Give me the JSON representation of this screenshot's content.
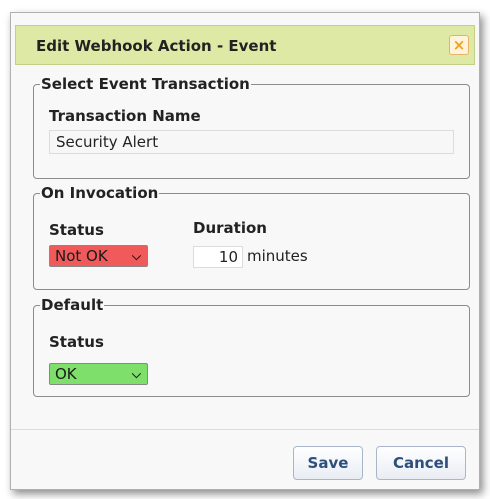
{
  "dialog": {
    "title": "Edit Webhook Action - Event",
    "close_glyph": "×"
  },
  "select_event": {
    "legend": "Select Event Transaction",
    "name_label": "Transaction Name",
    "name_value": "Security Alert"
  },
  "on_invocation": {
    "legend": "On Invocation",
    "status_label": "Status",
    "status_value": "Not OK",
    "status_color": "#f05a5a",
    "duration_label": "Duration",
    "duration_value": "10",
    "duration_unit": "minutes"
  },
  "default": {
    "legend": "Default",
    "status_label": "Status",
    "status_value": "OK",
    "status_color": "#7ee06a"
  },
  "buttons": {
    "save": "Save",
    "cancel": "Cancel"
  },
  "icons": {
    "close": "close-icon",
    "dropdown": "chevron-down-icon"
  }
}
